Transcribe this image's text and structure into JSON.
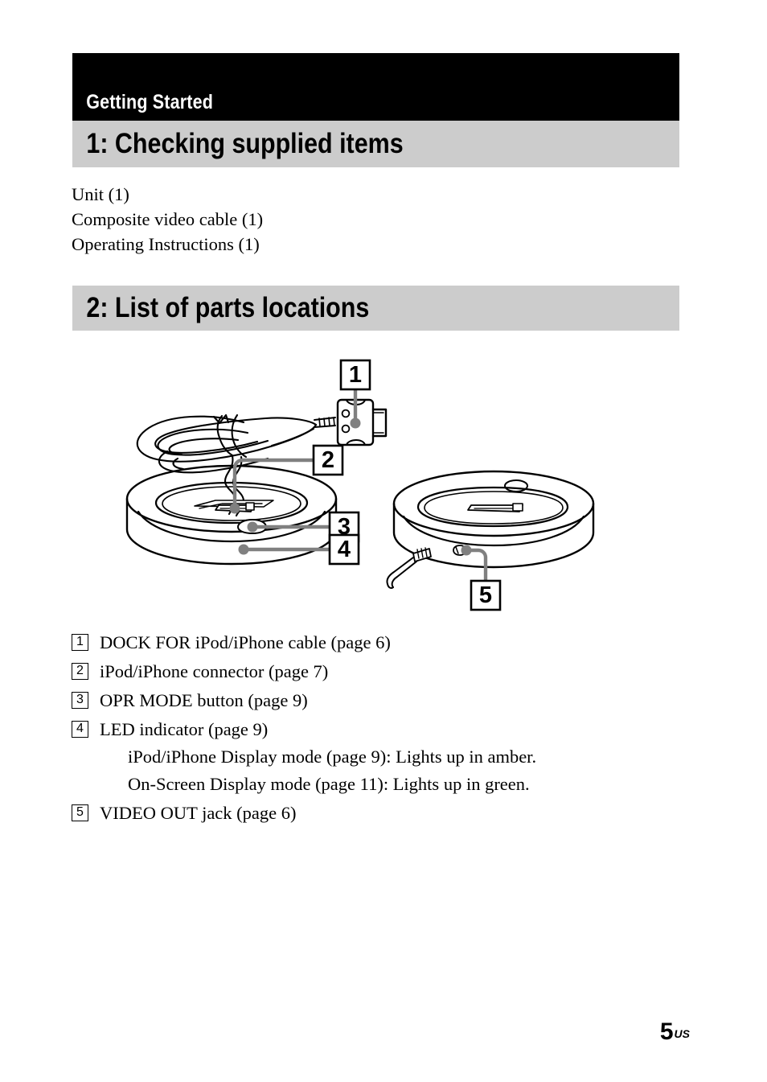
{
  "document": {
    "running_head": "Getting Started",
    "page_number": "5",
    "page_number_suffix": "US"
  },
  "sections": [
    {
      "id": "checking-supplied-items",
      "title": "1: Checking supplied items",
      "items": [
        "Unit (1)",
        "Composite video cable (1)",
        "Operating Instructions (1)"
      ]
    },
    {
      "id": "list-of-parts-locations",
      "title": "2: List of parts locations"
    }
  ],
  "illustration": {
    "alt": "Line drawing of the dock unit with coiled composite video cable, shown from the front-left and from the rear",
    "callouts": [
      {
        "number": "1",
        "target": "dock-for-ipod-iphone-cable"
      },
      {
        "number": "2",
        "target": "ipod-iphone-connector"
      },
      {
        "number": "3",
        "target": "opr-mode-button"
      },
      {
        "number": "4",
        "target": "led-indicator"
      },
      {
        "number": "5",
        "target": "video-out-jack"
      }
    ]
  },
  "legend": [
    {
      "number": "1",
      "text": "DOCK FOR iPod/iPhone cable (page 6)",
      "subtexts": []
    },
    {
      "number": "2",
      "text": "iPod/iPhone connector (page 7)",
      "subtexts": []
    },
    {
      "number": "3",
      "text": "OPR MODE button (page 9)",
      "subtexts": []
    },
    {
      "number": "4",
      "text": "LED indicator (page 9)",
      "subtexts": [
        "iPod/iPhone Display mode (page 9): Lights up in amber.",
        "On-Screen Display mode (page 11): Lights up in green."
      ]
    },
    {
      "number": "5",
      "text": "VIDEO OUT jack (page 6)",
      "subtexts": []
    }
  ],
  "colors": {
    "running_head_bg": "#000000",
    "running_head_fg": "#ffffff",
    "section_bar_bg": "#cccccc",
    "text": "#000000",
    "leader_line": "#808080"
  }
}
